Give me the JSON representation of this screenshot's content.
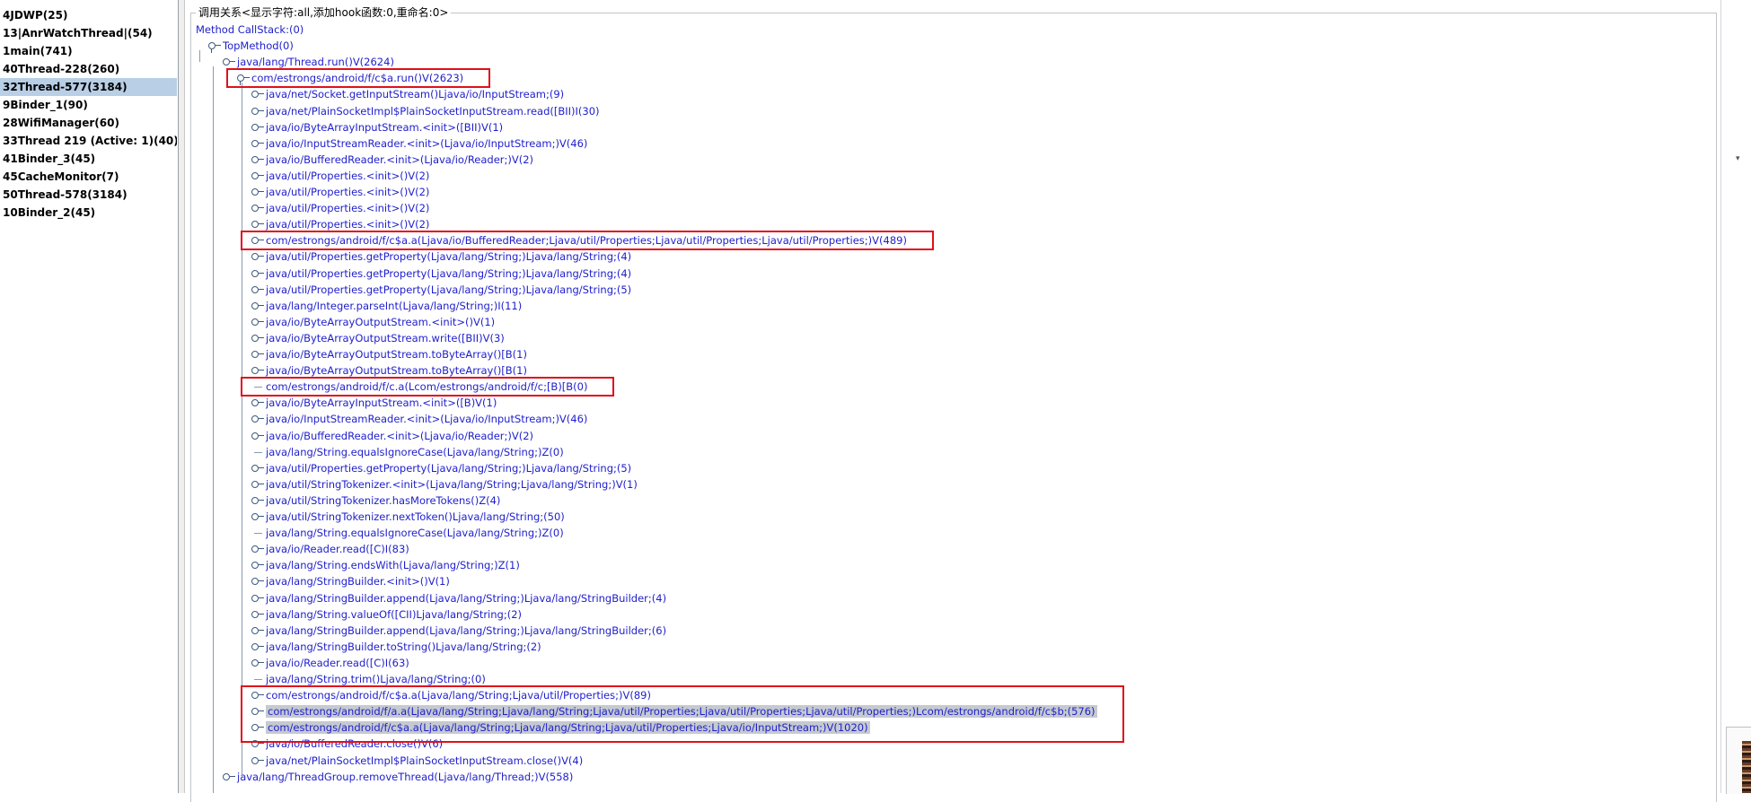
{
  "threads": [
    {
      "label": "4JDWP(25)",
      "selected": false
    },
    {
      "label": "13|AnrWatchThread|(54)",
      "selected": false
    },
    {
      "label": "1main(741)",
      "selected": false
    },
    {
      "label": "40Thread-228(260)",
      "selected": false
    },
    {
      "label": "32Thread-577(3184)",
      "selected": true
    },
    {
      "label": "9Binder_1(90)",
      "selected": false
    },
    {
      "label": "28WifiManager(60)",
      "selected": false
    },
    {
      "label": "33Thread 219 (Active: 1)(40)",
      "selected": false
    },
    {
      "label": "41Binder_3(45)",
      "selected": false
    },
    {
      "label": "45CacheMonitor(7)",
      "selected": false
    },
    {
      "label": "50Thread-578(3184)",
      "selected": false
    },
    {
      "label": "10Binder_2(45)",
      "selected": false
    }
  ],
  "call_panel": {
    "title": "调用关系<显示字符:all,添加hook函数:0,重命名:0>"
  },
  "tree": [
    {
      "label": "Method CallStack:(0)",
      "level": 0,
      "icon": "none"
    },
    {
      "label": "TopMethod(0)",
      "level": 1,
      "icon": "open"
    },
    {
      "label": "java/lang/Thread.run()V(2624)",
      "level": 2,
      "icon": "closed"
    },
    {
      "label": "com/estrongs/android/f/c$a.run()V(2623)",
      "level": 3,
      "icon": "open"
    },
    {
      "label": "java/net/Socket.getInputStream()Ljava/io/InputStream;(9)",
      "level": 4,
      "icon": "closed"
    },
    {
      "label": "java/net/PlainSocketImpl$PlainSocketInputStream.read([BII)I(30)",
      "level": 4,
      "icon": "closed"
    },
    {
      "label": "java/io/ByteArrayInputStream.<init>([BII)V(1)",
      "level": 4,
      "icon": "closed"
    },
    {
      "label": "java/io/InputStreamReader.<init>(Ljava/io/InputStream;)V(46)",
      "level": 4,
      "icon": "closed"
    },
    {
      "label": "java/io/BufferedReader.<init>(Ljava/io/Reader;)V(2)",
      "level": 4,
      "icon": "closed"
    },
    {
      "label": "java/util/Properties.<init>()V(2)",
      "level": 4,
      "icon": "closed"
    },
    {
      "label": "java/util/Properties.<init>()V(2)",
      "level": 4,
      "icon": "closed"
    },
    {
      "label": "java/util/Properties.<init>()V(2)",
      "level": 4,
      "icon": "closed"
    },
    {
      "label": "java/util/Properties.<init>()V(2)",
      "level": 4,
      "icon": "closed"
    },
    {
      "label": "com/estrongs/android/f/c$a.a(Ljava/io/BufferedReader;Ljava/util/Properties;Ljava/util/Properties;Ljava/util/Properties;)V(489)",
      "level": 4,
      "icon": "closed"
    },
    {
      "label": "java/util/Properties.getProperty(Ljava/lang/String;)Ljava/lang/String;(4)",
      "level": 4,
      "icon": "closed"
    },
    {
      "label": "java/util/Properties.getProperty(Ljava/lang/String;)Ljava/lang/String;(4)",
      "level": 4,
      "icon": "closed"
    },
    {
      "label": "java/util/Properties.getProperty(Ljava/lang/String;)Ljava/lang/String;(5)",
      "level": 4,
      "icon": "closed"
    },
    {
      "label": "java/lang/Integer.parseInt(Ljava/lang/String;)I(11)",
      "level": 4,
      "icon": "closed"
    },
    {
      "label": "java/io/ByteArrayOutputStream.<init>()V(1)",
      "level": 4,
      "icon": "closed"
    },
    {
      "label": "java/io/ByteArrayOutputStream.write([BII)V(3)",
      "level": 4,
      "icon": "closed"
    },
    {
      "label": "java/io/ByteArrayOutputStream.toByteArray()[B(1)",
      "level": 4,
      "icon": "closed"
    },
    {
      "label": "java/io/ByteArrayOutputStream.toByteArray()[B(1)",
      "level": 4,
      "icon": "closed"
    },
    {
      "label": "com/estrongs/android/f/c.a(Lcom/estrongs/android/f/c;[B)[B(0)",
      "level": 4,
      "icon": "leaf"
    },
    {
      "label": "java/io/ByteArrayInputStream.<init>([B)V(1)",
      "level": 4,
      "icon": "closed"
    },
    {
      "label": "java/io/InputStreamReader.<init>(Ljava/io/InputStream;)V(46)",
      "level": 4,
      "icon": "closed"
    },
    {
      "label": "java/io/BufferedReader.<init>(Ljava/io/Reader;)V(2)",
      "level": 4,
      "icon": "closed"
    },
    {
      "label": "java/lang/String.equalsIgnoreCase(Ljava/lang/String;)Z(0)",
      "level": 4,
      "icon": "leaf"
    },
    {
      "label": "java/util/Properties.getProperty(Ljava/lang/String;)Ljava/lang/String;(5)",
      "level": 4,
      "icon": "closed"
    },
    {
      "label": "java/util/StringTokenizer.<init>(Ljava/lang/String;Ljava/lang/String;)V(1)",
      "level": 4,
      "icon": "closed"
    },
    {
      "label": "java/util/StringTokenizer.hasMoreTokens()Z(4)",
      "level": 4,
      "icon": "closed"
    },
    {
      "label": "java/util/StringTokenizer.nextToken()Ljava/lang/String;(50)",
      "level": 4,
      "icon": "closed"
    },
    {
      "label": "java/lang/String.equalsIgnoreCase(Ljava/lang/String;)Z(0)",
      "level": 4,
      "icon": "leaf"
    },
    {
      "label": "java/io/Reader.read([C)I(83)",
      "level": 4,
      "icon": "closed"
    },
    {
      "label": "java/lang/String.endsWith(Ljava/lang/String;)Z(1)",
      "level": 4,
      "icon": "closed"
    },
    {
      "label": "java/lang/StringBuilder.<init>()V(1)",
      "level": 4,
      "icon": "closed"
    },
    {
      "label": "java/lang/StringBuilder.append(Ljava/lang/String;)Ljava/lang/StringBuilder;(4)",
      "level": 4,
      "icon": "closed"
    },
    {
      "label": "java/lang/String.valueOf([CII)Ljava/lang/String;(2)",
      "level": 4,
      "icon": "closed"
    },
    {
      "label": "java/lang/StringBuilder.append(Ljava/lang/String;)Ljava/lang/StringBuilder;(6)",
      "level": 4,
      "icon": "closed"
    },
    {
      "label": "java/lang/StringBuilder.toString()Ljava/lang/String;(2)",
      "level": 4,
      "icon": "closed"
    },
    {
      "label": "java/io/Reader.read([C)I(63)",
      "level": 4,
      "icon": "closed"
    },
    {
      "label": "java/lang/String.trim()Ljava/lang/String;(0)",
      "level": 4,
      "icon": "leaf"
    },
    {
      "label": "com/estrongs/android/f/c$a.a(Ljava/lang/String;Ljava/util/Properties;)V(89)",
      "level": 4,
      "icon": "closed"
    },
    {
      "label": "com/estrongs/android/f/a.a(Ljava/lang/String;Ljava/lang/String;Ljava/util/Properties;Ljava/util/Properties;Ljava/util/Properties;)Lcom/estrongs/android/f/c$b;(576)",
      "level": 4,
      "icon": "closed",
      "highlight": true
    },
    {
      "label": "com/estrongs/android/f/c$a.a(Ljava/lang/String;Ljava/lang/String;Ljava/util/Properties;Ljava/io/InputStream;)V(1020)",
      "level": 4,
      "icon": "closed",
      "highlight": true
    },
    {
      "label": "java/io/BufferedReader.close()V(6)",
      "level": 4,
      "icon": "closed"
    },
    {
      "label": "java/net/PlainSocketImpl$PlainSocketInputStream.close()V(4)",
      "level": 4,
      "icon": "closed"
    },
    {
      "label": "java/lang/ThreadGroup.removeThread(Ljava/lang/Thread;)V(558)",
      "level": 2,
      "icon": "closed"
    }
  ],
  "annotations": [
    {
      "covers": [
        3,
        3
      ]
    },
    {
      "covers": [
        13,
        13
      ]
    },
    {
      "covers": [
        22,
        22
      ]
    },
    {
      "covers": [
        41,
        43
      ]
    }
  ],
  "colors": {
    "tree_text": "#1e1ecc",
    "selection": "#b8cfe5",
    "annotation_box": "#e0101a"
  },
  "icons": {
    "expanded_node": "tree-node-open-icon",
    "collapsed_node": "tree-node-closed-icon",
    "scroll_down": "chevron-down-icon"
  }
}
